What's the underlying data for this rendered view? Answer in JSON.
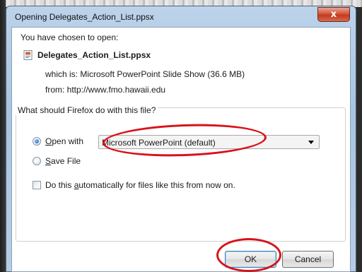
{
  "dialog": {
    "title": "Opening Delegates_Action_List.ppsx",
    "close_glyph": "x"
  },
  "content": {
    "chosen_text": "You have chosen to open:",
    "file_name": "Delegates_Action_List.ppsx",
    "file_icon": "powerpoint-file-icon",
    "which_is": "which is:  Microsoft PowerPoint Slide Show (36.6 MB)",
    "from": "from:  http://www.fmo.hawaii.edu"
  },
  "action_group": {
    "title": "What should Firefox do with this file?",
    "open_with_label": "Open with",
    "open_with_selected": true,
    "application": "Microsoft PowerPoint (default)",
    "save_file_label": "Save File",
    "save_file_selected": false,
    "auto_label": "Do this automatically for files like this from now on.",
    "auto_checked": false
  },
  "buttons": {
    "ok": "OK",
    "cancel": "Cancel"
  },
  "annotation_color": "#d8121b"
}
